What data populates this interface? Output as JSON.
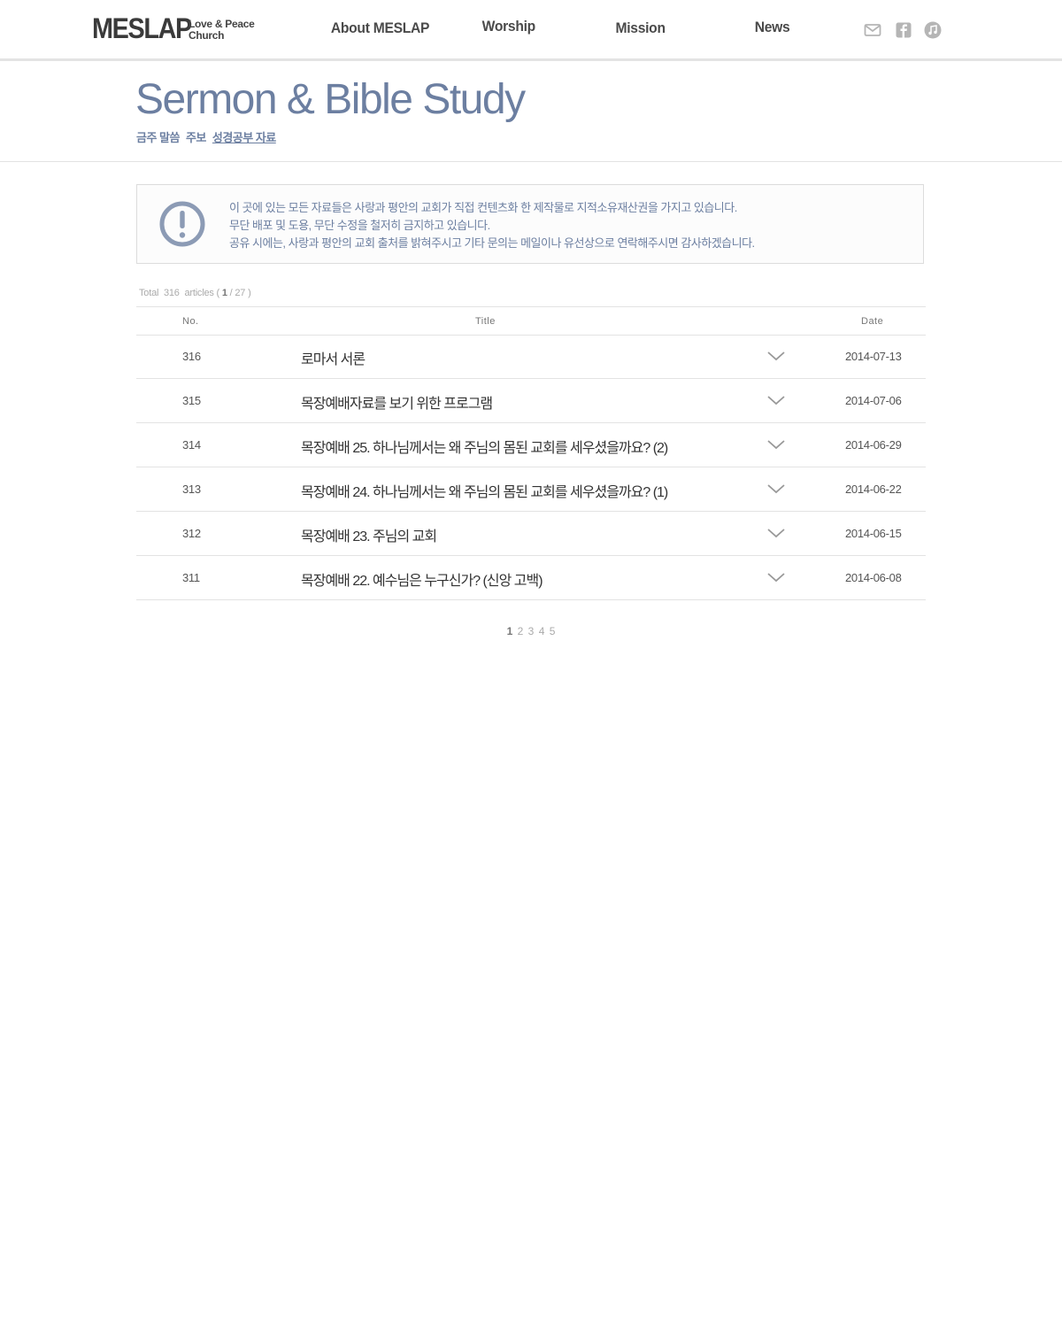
{
  "header": {
    "logo": "MESLAP",
    "logo_sub_line1": "Love & Peace",
    "logo_sub_line2": "Church",
    "nav": [
      "About MESLAP",
      "Worship",
      "Mission",
      "News"
    ],
    "social_icons": [
      "mail-icon",
      "facebook-icon",
      "music-icon"
    ]
  },
  "page": {
    "title": "Sermon & Bible Study",
    "subnav": [
      "금주 말씀",
      "주보",
      "성경공부 자료"
    ],
    "subnav_active": "성경공부 자료"
  },
  "notice": {
    "icon": "exclamation-circle-icon",
    "lines": [
      "이 곳에 있는 모든 자료들은 사랑과 평안의 교회가 직접 컨텐츠화 한 제작물로 지적소유재산권을 가지고 있습니다.",
      "무단 배포 및 도용, 무단 수정을 철저히 금지하고 있습니다.",
      "공유 시에는, 사랑과 평안의 교회 출처를 밝혀주시고 기타 문의는 메일이나 유선상으로 연락해주시면 감사하겠습니다."
    ]
  },
  "board": {
    "total_label": "Total",
    "total_count": "316",
    "articles_label": "articles (",
    "current_page": "1",
    "separator": "/",
    "total_pages": "27",
    "close_paren": ")",
    "columns": {
      "no": "No.",
      "title": "Title",
      "date": "Date"
    },
    "rows": [
      {
        "no": "316",
        "title": "로마서 서론",
        "date": "2014-07-13"
      },
      {
        "no": "315",
        "title": "목장예배자료를 보기 위한 프로그램",
        "date": "2014-07-06"
      },
      {
        "no": "314",
        "title": "목장예배 25. 하나님께서는 왜 주님의 몸된 교회를 세우셨을까요? (2)",
        "date": "2014-06-29"
      },
      {
        "no": "313",
        "title": "목장예배 24. 하나님께서는 왜 주님의 몸된 교회를 세우셨을까요? (1)",
        "date": "2014-06-22"
      },
      {
        "no": "312",
        "title": "목장예배 23. 주님의 교회",
        "date": "2014-06-15"
      },
      {
        "no": "311",
        "title": "목장예배 22. 예수님은 누구신가? (신앙 고백)",
        "date": "2014-06-08"
      }
    ]
  },
  "pager": {
    "pages": [
      "1",
      "2",
      "3",
      "4",
      "5"
    ],
    "current": "1"
  },
  "colors": {
    "accent": "#6c7fa1",
    "border": "#e3e3e3",
    "text": "#333333"
  }
}
